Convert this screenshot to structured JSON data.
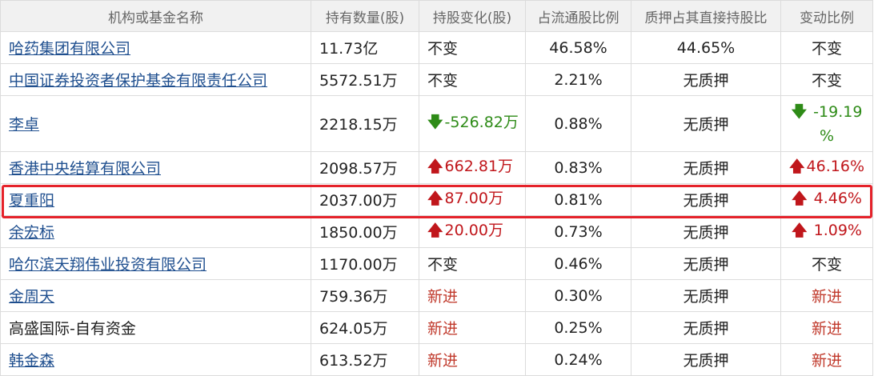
{
  "headers": {
    "name": "机构或基金名称",
    "quantity": "持有数量(股)",
    "change": "持股变化(股)",
    "float_ratio": "占流通股比例",
    "pledge_ratio": "质押占其直接持股比",
    "change_ratio": "变动比例"
  },
  "rows": [
    {
      "name": "哈药集团有限公司",
      "quantity": "11.73亿",
      "change": "不变",
      "change_dir": "none",
      "float_ratio": "46.58%",
      "pledge_ratio": "44.65%",
      "change_ratio": "不变",
      "change_ratio_dir": "none"
    },
    {
      "name": "中国证券投资者保护基金有限责任公司",
      "quantity": "5572.51万",
      "change": "不变",
      "change_dir": "none",
      "float_ratio": "2.21%",
      "pledge_ratio": "无质押",
      "change_ratio": "不变",
      "change_ratio_dir": "none"
    },
    {
      "name": "李卓",
      "quantity": "2218.15万",
      "change": "-526.82万",
      "change_dir": "down",
      "float_ratio": "0.88%",
      "pledge_ratio": "无质押",
      "change_ratio_line1": "-19.19",
      "change_ratio_line2": "%",
      "change_ratio_dir": "down"
    },
    {
      "name": "香港中央结算有限公司",
      "quantity": "2098.57万",
      "change": "662.81万",
      "change_dir": "up",
      "float_ratio": "0.83%",
      "pledge_ratio": "无质押",
      "change_ratio": "46.16%",
      "change_ratio_dir": "up"
    },
    {
      "name": "夏重阳",
      "quantity": "2037.00万",
      "change": "87.00万",
      "change_dir": "up",
      "float_ratio": "0.81%",
      "pledge_ratio": "无质押",
      "change_ratio": "4.46%",
      "change_ratio_dir": "up"
    },
    {
      "name": "余宏标",
      "quantity": "1850.00万",
      "change": "20.00万",
      "change_dir": "up",
      "float_ratio": "0.73%",
      "pledge_ratio": "无质押",
      "change_ratio": "1.09%",
      "change_ratio_dir": "up"
    },
    {
      "name": "哈尔滨天翔伟业投资有限公司",
      "quantity": "1170.00万",
      "change": "不变",
      "change_dir": "none",
      "float_ratio": "0.46%",
      "pledge_ratio": "无质押",
      "change_ratio": "不变",
      "change_ratio_dir": "none"
    },
    {
      "name": "金周天",
      "quantity": "759.36万",
      "change": "新进",
      "change_dir": "new",
      "float_ratio": "0.30%",
      "pledge_ratio": "无质押",
      "change_ratio": "新进",
      "change_ratio_dir": "new"
    },
    {
      "name": "高盛国际-自有资金",
      "quantity": "624.05万",
      "change": "新进",
      "change_dir": "new",
      "float_ratio": "0.25%",
      "pledge_ratio": "无质押",
      "change_ratio": "新进",
      "change_ratio_dir": "new"
    },
    {
      "name": "韩金森",
      "quantity": "613.52万",
      "change": "新进",
      "change_dir": "new",
      "float_ratio": "0.24%",
      "pledge_ratio": "无质押",
      "change_ratio": "新进",
      "change_ratio_dir": "new"
    }
  ],
  "icons": {
    "up": "arrow-up-icon",
    "down": "arrow-down-icon"
  },
  "colors": {
    "up": "#c0161b",
    "down": "#2e8b17",
    "new": "#c0392b",
    "link": "#1f4f8f",
    "highlight": "#e5222a"
  }
}
